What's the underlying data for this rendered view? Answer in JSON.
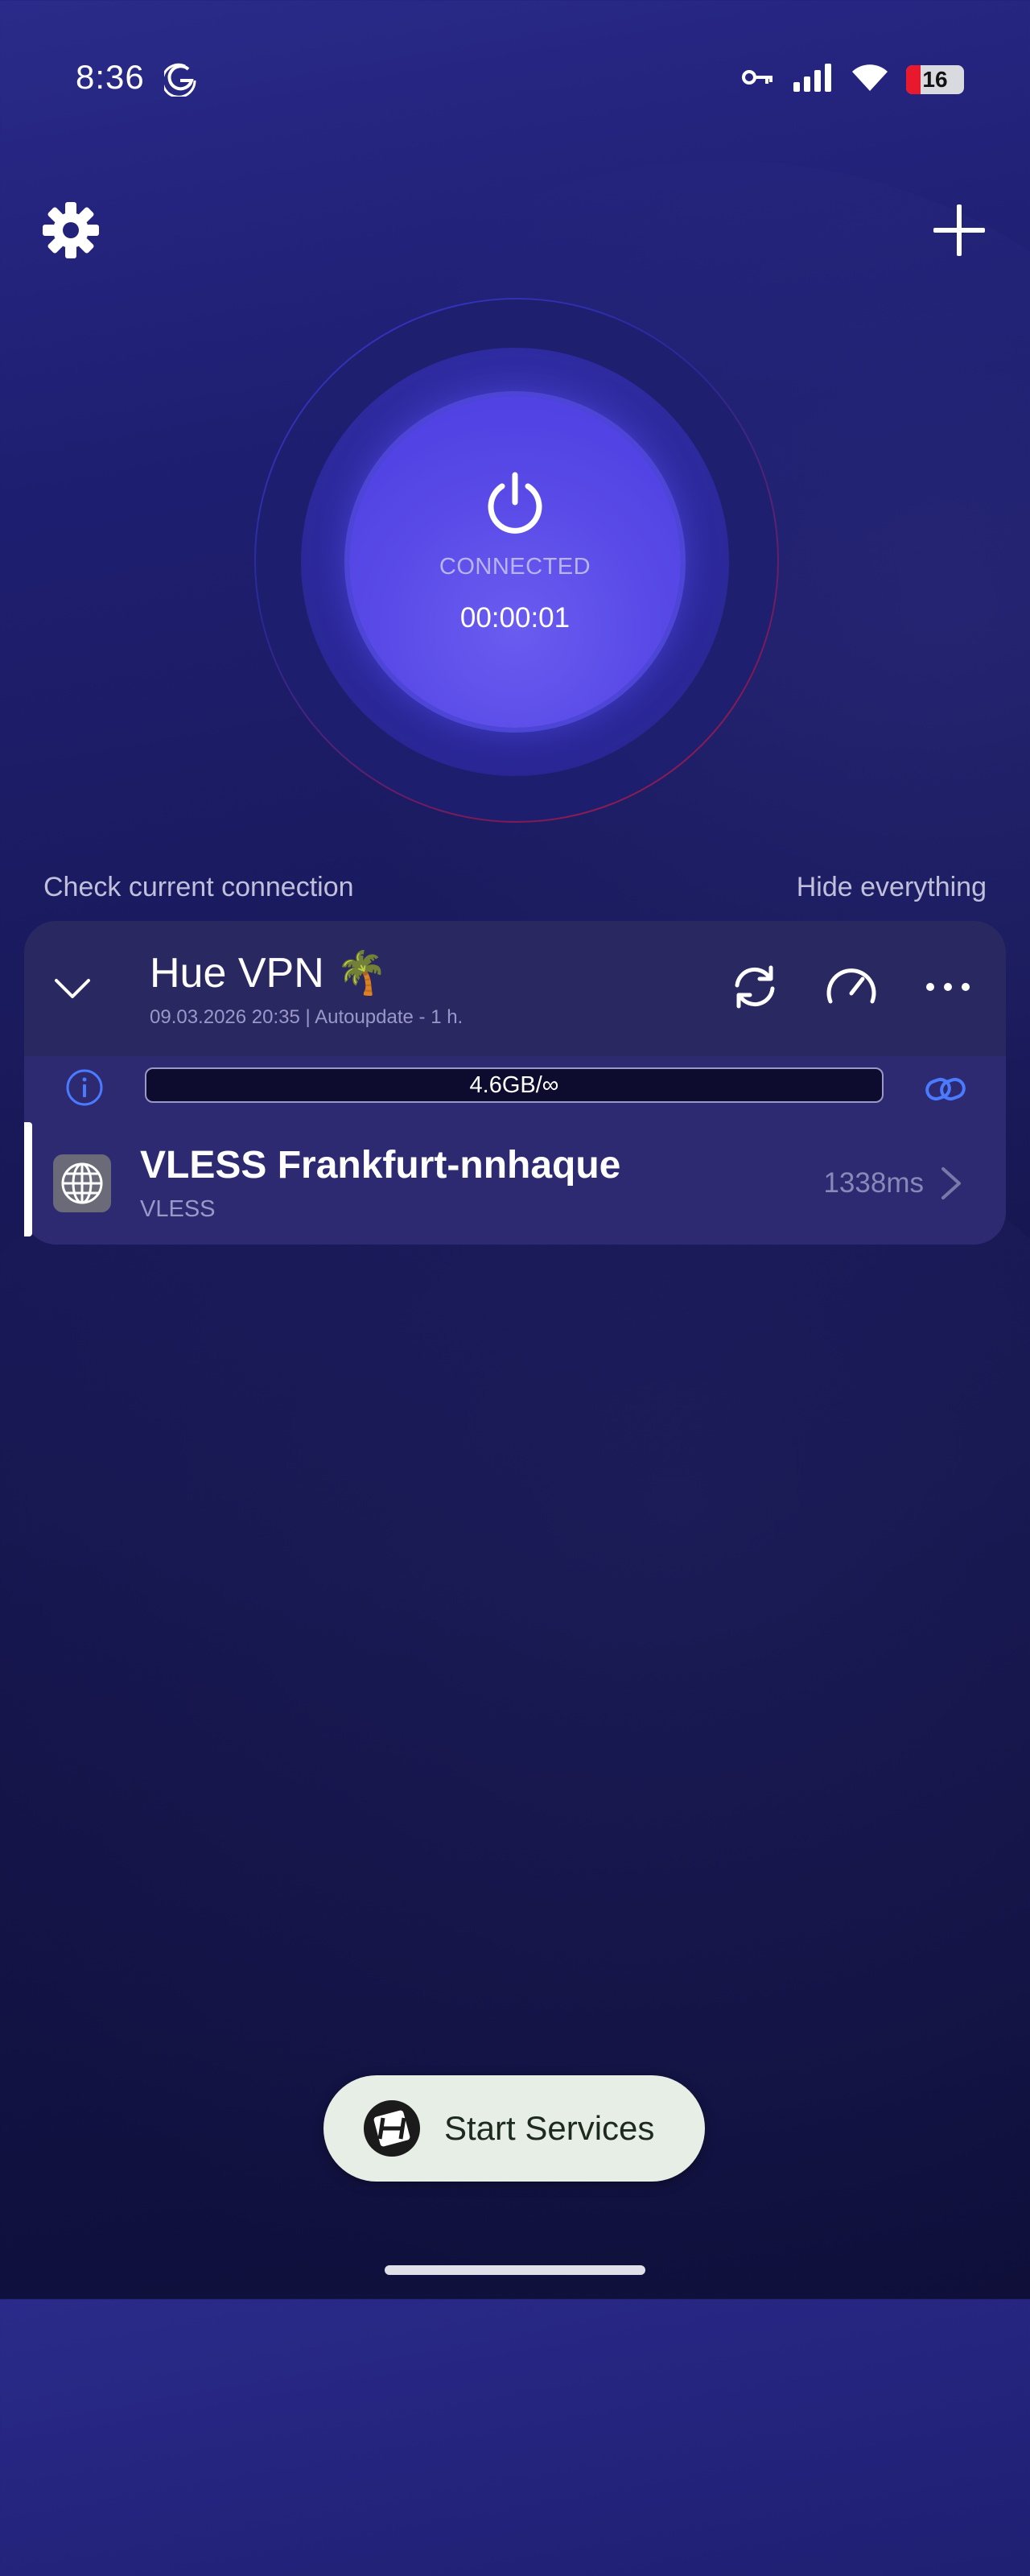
{
  "status_bar": {
    "time": "8:36",
    "battery_level": "16"
  },
  "power": {
    "status": "CONNECTED",
    "timer": "00:00:01"
  },
  "links": {
    "check_connection": "Check current connection",
    "hide_everything": "Hide everything"
  },
  "subscription": {
    "title": "Hue VPN 🌴",
    "subtitle": "09.03.2026 20:35 | Autoupdate - 1 h.",
    "usage": "4.6GB/∞"
  },
  "server": {
    "name": "VLESS Frankfurt-nnhaque",
    "protocol": "VLESS",
    "ping": "1338ms"
  },
  "toast": {
    "label": "Start Services"
  },
  "colors": {
    "accent": "#5a4be8",
    "battery_low": "#e8192c",
    "link_icon": "#4a7bff"
  }
}
